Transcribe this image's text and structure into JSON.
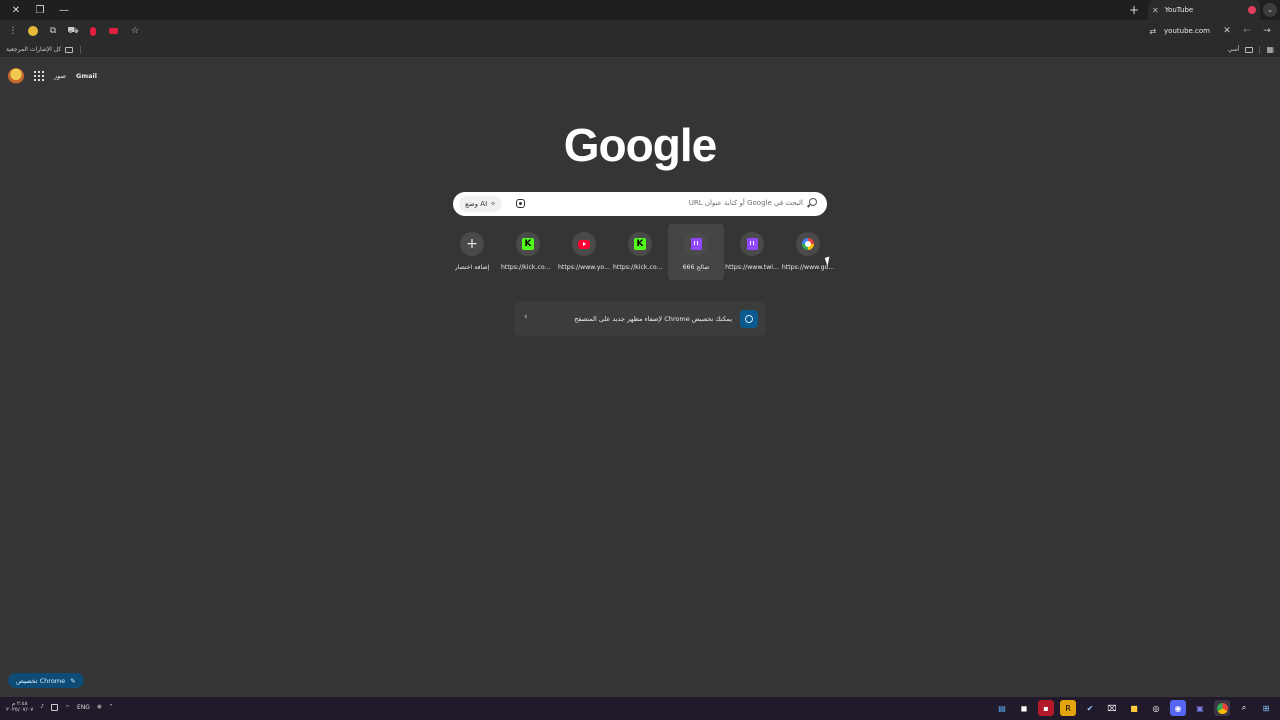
{
  "window": {
    "tab_title": "YouTube"
  },
  "toolbar": {
    "url": "youtube.com"
  },
  "bookmarks": {
    "all_bookmarks_label": "كل الإشارات المرجعية",
    "right_folder_label": "أسي"
  },
  "ntp_header": {
    "gmail_label": "Gmail",
    "images_label": "صور"
  },
  "logo_text": "Google",
  "search": {
    "placeholder": "البحث في Google أو كتابة عنوان URL",
    "ai_mode_label": "وضع AI"
  },
  "shortcuts": [
    {
      "label": "https://www.go...",
      "icon": "google-icon"
    },
    {
      "label": "https://www.twi...",
      "icon": "twitch-icon"
    },
    {
      "label": "صالح 666",
      "icon": "twitch-icon"
    },
    {
      "label": "https://kick.com...",
      "icon": "kick-icon"
    },
    {
      "label": "https://www.yo...",
      "icon": "youtube-icon"
    },
    {
      "label": "https://kick.com...",
      "icon": "kick-icon"
    },
    {
      "label": "إضافة اختصار",
      "icon": "plus-icon"
    }
  ],
  "promo": {
    "text": "يمكنك تخصيص Chrome لإضفاء مظهر جديد على المتصفح"
  },
  "customize_button": {
    "label": "تخصيص Chrome"
  },
  "taskbar": {
    "language": "ENG",
    "time": "٢:٤٨ م",
    "date": "٢٠٢٥/٠٧/٠٧"
  }
}
